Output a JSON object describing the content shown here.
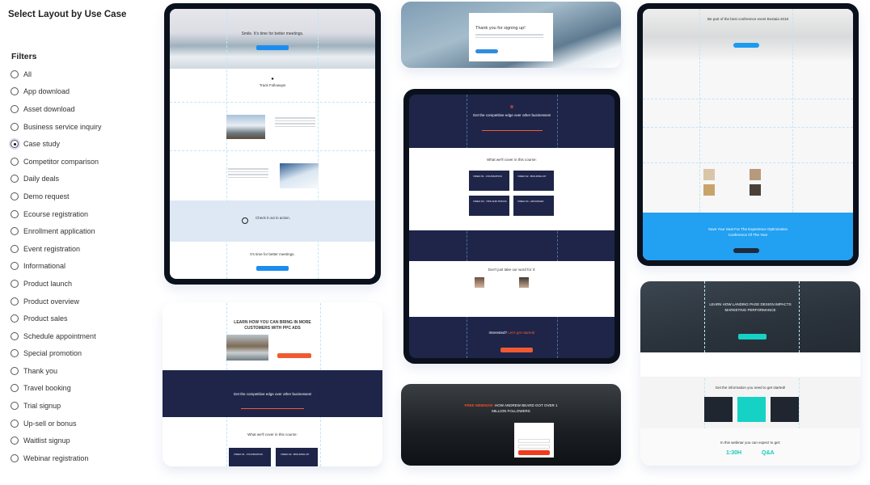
{
  "sidebar": {
    "title": "Select Layout by Use Case",
    "filters_label": "Filters",
    "selected": "Case study",
    "options": [
      "All",
      "App download",
      "Asset download",
      "Business service inquiry",
      "Case study",
      "Competitor comparison",
      "Daily deals",
      "Demo request",
      "Ecourse registration",
      "Enrollment application",
      "Event registration",
      "Informational",
      "Product launch",
      "Product overview",
      "Product sales",
      "Schedule appointment",
      "Special promotion",
      "Thank you",
      "Travel booking",
      "Trial signup",
      "Up-sell or bonus",
      "Waitlist signup",
      "Webinar registration"
    ]
  },
  "templates": {
    "meetings": {
      "headline": "Smile. It's time for better meetings.",
      "section1": "Track Followups",
      "section2": "Check it out in action.",
      "footer": "It's time for better meetings."
    },
    "thankyou": {
      "headline": "Thank you for signing up!"
    },
    "course": {
      "headline": "Get the competitive edge over other businesses!",
      "cover": "What we'll cover in this course:",
      "videos": [
        "VIDEO #1 - FOUNDATION",
        "VIDEO #2 - BUILDING UP",
        "VIDEO #3 - TIPS AND TRICKS",
        "VIDEO #4 - ADVANCED"
      ],
      "testimonials": "Don't just take our word for it:",
      "cta_pre": "Interested?",
      "cta_accent": "Let's get started!"
    },
    "conference": {
      "headline": "Be part of the best conference event Bostaia 2018",
      "footer_line1": "Save Your Seat For The Experience Optimization",
      "footer_line2": "Conference Of The Year"
    },
    "ppc": {
      "headline_line1": "LEARN HOW YOU CAN BRING IN MORE",
      "headline_line2": "CUSTOMERS WITH PPC ADS",
      "subhead": "Get the competitive edge over other businesses!",
      "cover": "What we'll cover in this course:",
      "videos": [
        "VIDEO #1 - FOUNDATION",
        "VIDEO #2 - BUILDING UP"
      ]
    },
    "webinar_dark": {
      "headline_accent": "FREE WEBINAR:",
      "headline_line1": "HOW ANDREW BEARD GOT OVER 1",
      "headline_line2": "MILLION FOLLOWERS"
    },
    "landing": {
      "headline_line1": "LEARN HOW LANDING PAGE DESIGN IMPACTS",
      "headline_line2": "MARKETING PERFORMANCE",
      "info": "Get the information you need to get started!",
      "expect": "In this webinar you can expect to get:",
      "stat1": "1:30H",
      "stat2": "Q&A"
    }
  },
  "colors": {
    "accent_blue": "#1b8cf0",
    "navy": "#1e2549",
    "orange": "#f05a32",
    "teal": "#16d2c5",
    "conf_blue": "#20a0f0"
  }
}
